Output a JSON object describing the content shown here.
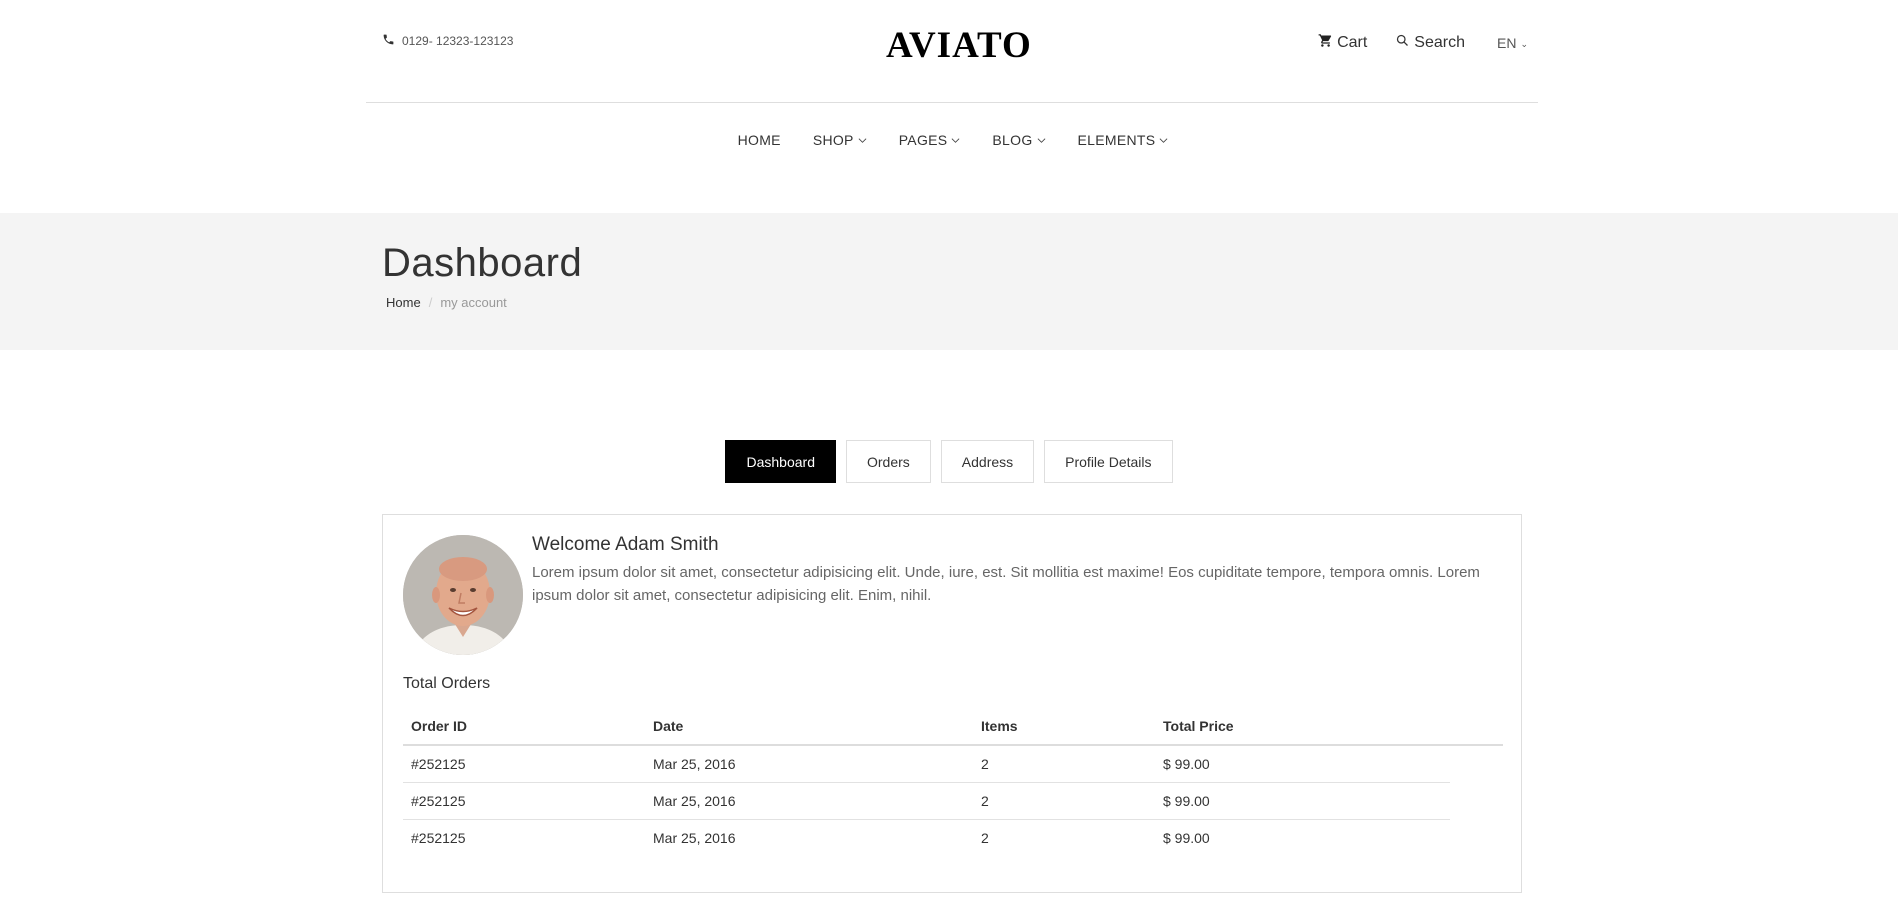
{
  "header": {
    "phone": "0129- 12323-123123",
    "logo": "AVIATO",
    "cart_label": "Cart",
    "search_label": "Search",
    "language": "EN"
  },
  "nav": {
    "items": [
      {
        "label": "HOME",
        "has_dropdown": false
      },
      {
        "label": "SHOP",
        "has_dropdown": true
      },
      {
        "label": "PAGES",
        "has_dropdown": true
      },
      {
        "label": "BLOG",
        "has_dropdown": true
      },
      {
        "label": "ELEMENTS",
        "has_dropdown": true
      }
    ]
  },
  "page_header": {
    "title": "Dashboard",
    "breadcrumb": {
      "home": "Home",
      "separator": "/",
      "current": "my account"
    }
  },
  "tabs": [
    {
      "label": "Dashboard",
      "active": true
    },
    {
      "label": "Orders",
      "active": false
    },
    {
      "label": "Address",
      "active": false
    },
    {
      "label": "Profile Details",
      "active": false
    }
  ],
  "dashboard": {
    "welcome_title": "Welcome Adam Smith",
    "welcome_text": "Lorem ipsum dolor sit amet, consectetur adipisicing elit. Unde, iure, est. Sit mollitia est maxime! Eos cupiditate tempore, tempora omnis. Lorem ipsum dolor sit amet, consectetur adipisicing elit. Enim, nihil.",
    "total_orders_label": "Total Orders",
    "table": {
      "headers": [
        "Order ID",
        "Date",
        "Items",
        "Total Price"
      ],
      "rows": [
        [
          "#252125",
          "Mar 25, 2016",
          "2",
          "$ 99.00"
        ],
        [
          "#252125",
          "Mar 25, 2016",
          "2",
          "$ 99.00"
        ],
        [
          "#252125",
          "Mar 25, 2016",
          "2",
          "$ 99.00"
        ]
      ]
    }
  },
  "colors": {
    "accent": "#000000",
    "header_band": "#f4f4f4",
    "border": "#dedede"
  }
}
